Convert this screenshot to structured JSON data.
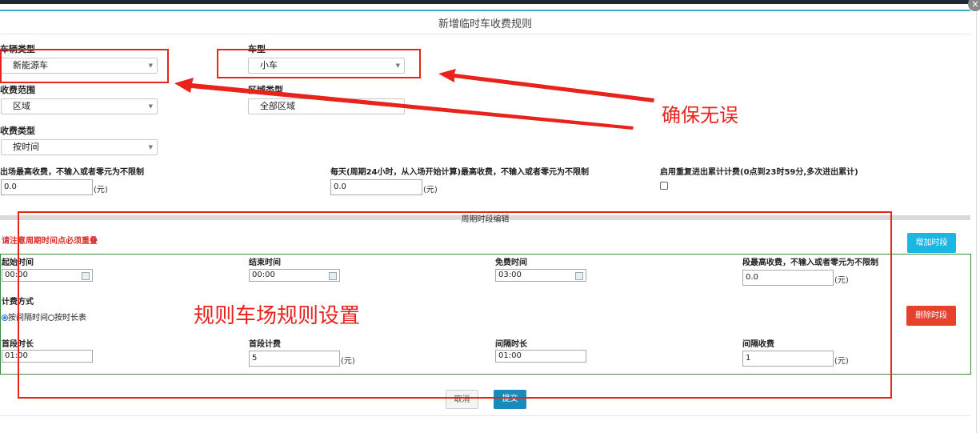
{
  "dialog": {
    "title": "新增临时车收费规则",
    "close": "×"
  },
  "fields": {
    "plate_type": {
      "label": "车辆类型",
      "value": "新能源车"
    },
    "car_model": {
      "label": "车型",
      "value": "小车"
    },
    "scope": {
      "label": "收费范围",
      "value": "区域"
    },
    "area_type": {
      "label": "区域类型",
      "value": "全部区域"
    },
    "charge_type": {
      "label": "收费类型",
      "value": "按时间"
    },
    "max_exit": {
      "label": "出场最高收费，不输入或者零元为不限制",
      "value": "0.0",
      "unit": "(元)"
    },
    "max_daily": {
      "label": "每天(周期24小时，从入场开始计算)最高收费，不输入或者零元为不限制",
      "value": "0.0",
      "unit": "(元)"
    },
    "repeat": {
      "label": "启用重复进出累计计费(0点到23时59分,多次进出累计)",
      "checked": false
    }
  },
  "period": {
    "title": "周期时段编辑",
    "warning": "请注意周期时间点必须重叠",
    "add_button": "增加时段",
    "delete_button": "删除时段",
    "start_time": {
      "label": "起始时间",
      "value": "00:00"
    },
    "end_time": {
      "label": "结束时间",
      "value": "00:00"
    },
    "free_time": {
      "label": "免费时间",
      "value": "03:00"
    },
    "segment_max": {
      "label": "段最高收费，不输入或者零元为不限制",
      "value": "0.0",
      "unit": "(元)"
    },
    "billing_mode": {
      "label": "计费方式",
      "option1": "按间隔时间",
      "option2": "按时长表",
      "selected": "按间隔时间"
    },
    "first_duration": {
      "label": "首段时长",
      "value": "01:00"
    },
    "first_fee": {
      "label": "首段计费",
      "value": "5",
      "unit": "(元)"
    },
    "interval_duration": {
      "label": "间隔时长",
      "value": "01:00"
    },
    "interval_fee": {
      "label": "间隔收费",
      "value": "1",
      "unit": "(元)"
    }
  },
  "footer": {
    "cancel": "取消",
    "submit": "提交"
  },
  "annotations": {
    "ensure_correct": "确保无误",
    "rule_setting": "规则车场规则设置"
  },
  "colors": {
    "annotation": "#e8231c",
    "add_button": "#1bb7e3",
    "delete_button": "#e6412d",
    "submit_button": "#1a8ab8",
    "green_border": "#3d8c40"
  }
}
